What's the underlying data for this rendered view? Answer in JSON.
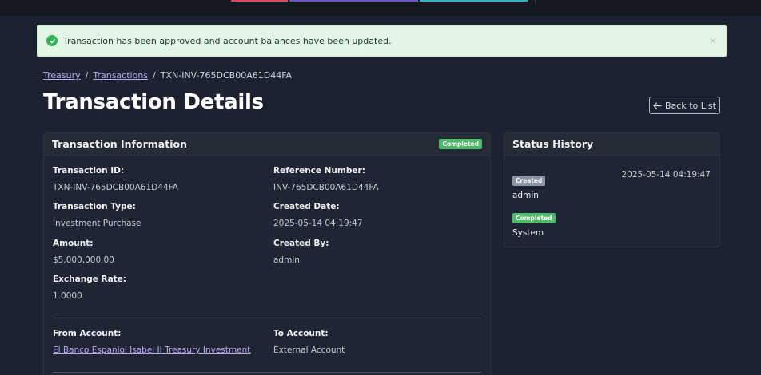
{
  "colors": {
    "top_segments": [
      "#e0475a",
      "#6a54c9",
      "#2bb3c9"
    ],
    "success": "#34b35a",
    "link": "#b7a8f5",
    "badge_completed": "#4fb86a",
    "badge_created": "#8b93a6"
  },
  "alert": {
    "message": "Transaction has been approved and account balances have been updated.",
    "close_icon": "×"
  },
  "breadcrumb": {
    "items": [
      "Treasury",
      "Transactions",
      "TXN-INV-765DCB00A61D44FA"
    ],
    "separator": "/"
  },
  "page": {
    "title": "Transaction Details",
    "back_label": "Back to List"
  },
  "info": {
    "title": "Transaction Information",
    "status_badge": "Completed",
    "fields": {
      "transaction_id": {
        "label": "Transaction ID:",
        "value": "TXN-INV-765DCB00A61D44FA"
      },
      "reference_number": {
        "label": "Reference Number:",
        "value": "INV-765DCB00A61D44FA"
      },
      "transaction_type": {
        "label": "Transaction Type:",
        "value": "Investment Purchase"
      },
      "created_date": {
        "label": "Created Date:",
        "value": "2025-05-14 04:19:47"
      },
      "amount": {
        "label": "Amount:",
        "value": "$5,000,000.00"
      },
      "created_by": {
        "label": "Created By:",
        "value": "admin"
      },
      "exchange_rate": {
        "label": "Exchange Rate:",
        "value": "1.0000"
      },
      "from_account": {
        "label": "From Account:",
        "value": "El Banco Espaniol Isabel II Treasury Investment"
      },
      "to_account": {
        "label": "To Account:",
        "value": "External Account"
      }
    }
  },
  "status_history": {
    "title": "Status History",
    "entries": [
      {
        "badge": "Created",
        "user": "admin",
        "time": "2025-05-14 04:19:47"
      },
      {
        "badge": "Completed",
        "user": "System"
      }
    ]
  }
}
